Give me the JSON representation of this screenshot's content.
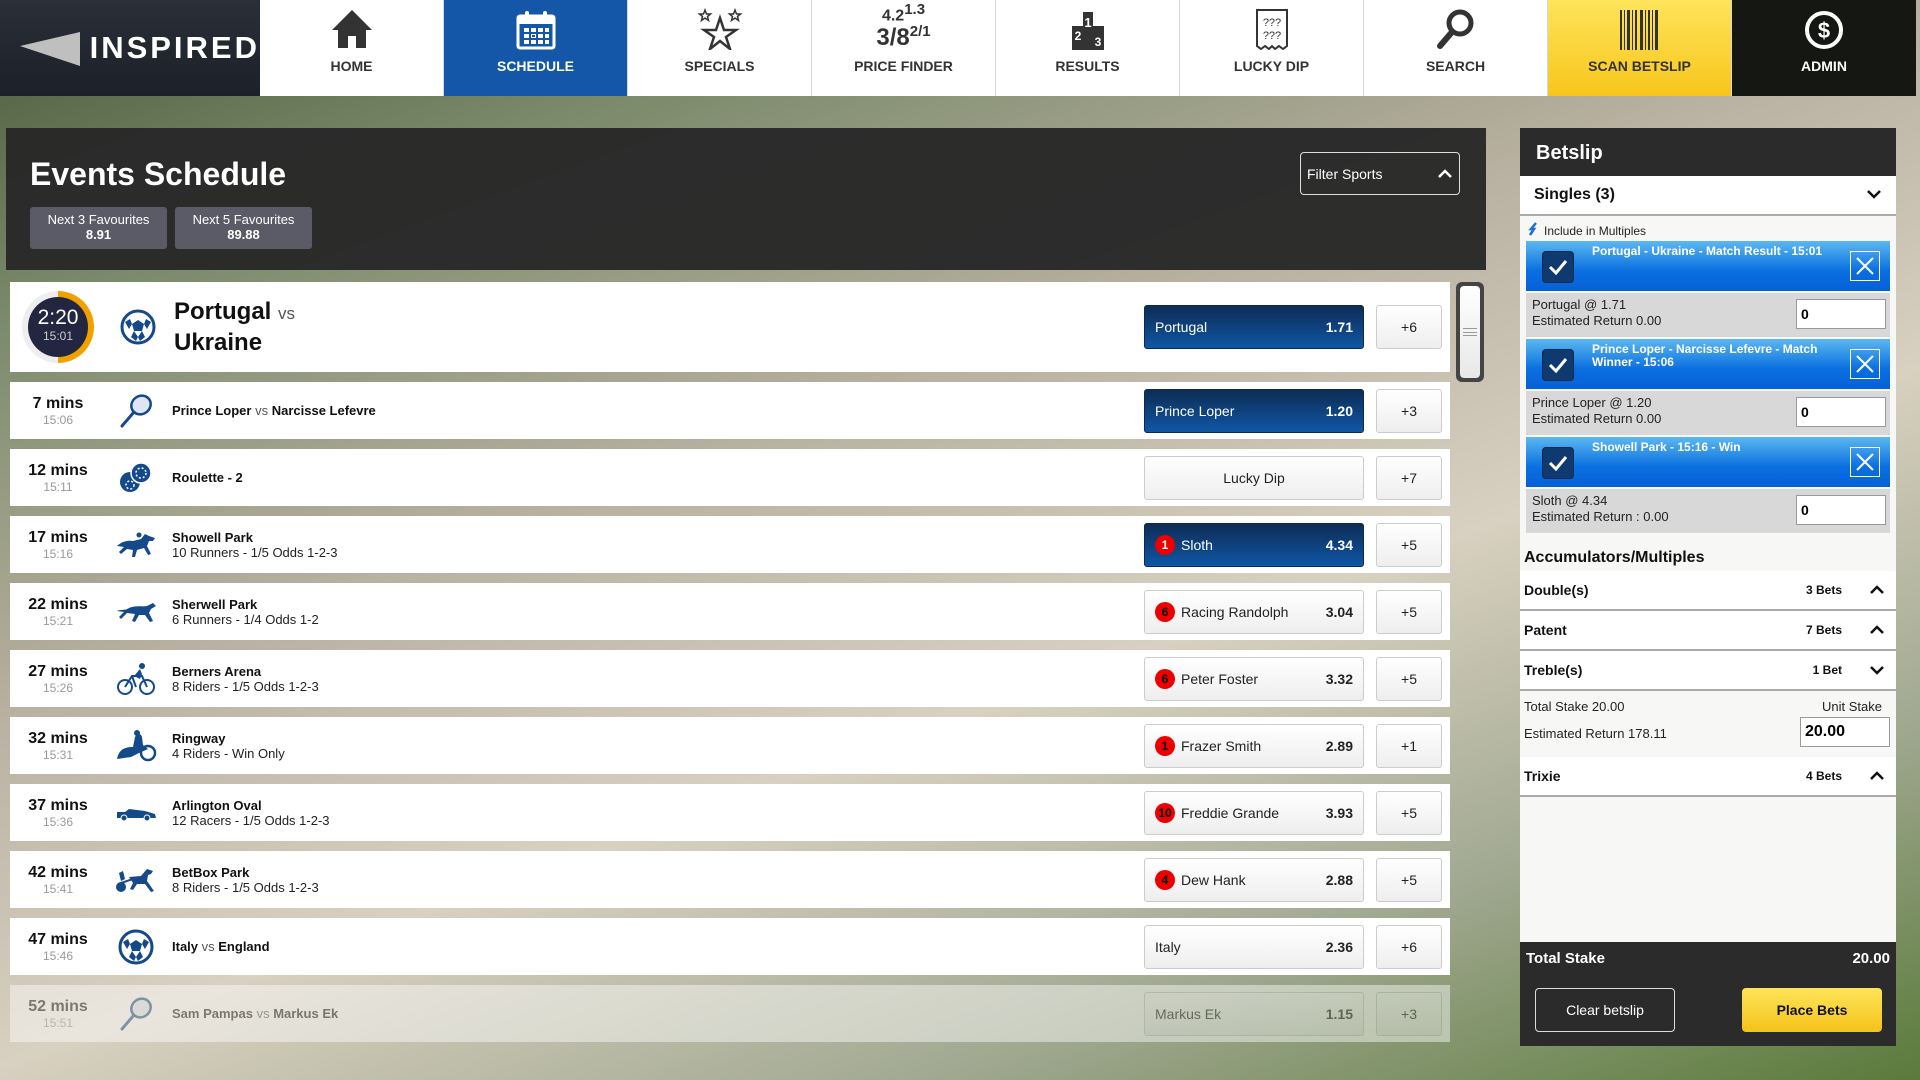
{
  "brand": {
    "name": "INSPIRED"
  },
  "nav": [
    {
      "id": "home",
      "label": "HOME",
      "icon": "home-icon"
    },
    {
      "id": "schedule",
      "label": "SCHEDULE",
      "icon": "calendar-icon",
      "active": true
    },
    {
      "id": "specials",
      "label": "SPECIALS",
      "icon": "stars-icon"
    },
    {
      "id": "price-finder",
      "label": "PRICE FINDER",
      "icon": "price-finder-icon",
      "icon_text": {
        "a": "4.2",
        "a_sup": "1.3",
        "b": "3/8",
        "b_sup": "2/1"
      }
    },
    {
      "id": "results",
      "label": "RESULTS",
      "icon": "podium-icon"
    },
    {
      "id": "lucky-dip",
      "label": "LUCKY DIP",
      "icon": "lucky-dip-icon"
    },
    {
      "id": "search",
      "label": "SEARCH",
      "icon": "search-icon"
    },
    {
      "id": "scan-betslip",
      "label": "SCAN BETSLIP",
      "icon": "barcode-icon"
    },
    {
      "id": "admin",
      "label": "ADMIN",
      "icon": "dollar-icon"
    }
  ],
  "events": {
    "title": "Events Schedule",
    "filter_label": "Filter Sports",
    "favourites": [
      {
        "label": "Next 3 Favourites",
        "value": "8.91"
      },
      {
        "label": "Next 5 Favourites",
        "value": "89.88"
      }
    ],
    "featured": {
      "countdown": "2:20",
      "time": "15:01",
      "countdown_progress": 0.5,
      "sport_icon": "football-icon",
      "home": "Portugal",
      "vs": "vs",
      "away": "Ukraine",
      "selection": "Portugal",
      "price": "1.71",
      "more": "+6",
      "selected": true
    },
    "rows": [
      {
        "mins": "7 mins",
        "time": "15:06",
        "sport_icon": "tennis-icon",
        "home": "Prince Loper",
        "vs": "vs",
        "away": "Narcisse Lefevre",
        "selection": "Prince Loper",
        "price": "1.20",
        "more": "+3",
        "selected": true
      },
      {
        "mins": "12 mins",
        "time": "15:11",
        "sport_icon": "roulette-chips-icon",
        "name": "Roulette - 2",
        "selection": "Lucky Dip",
        "more": "+7"
      },
      {
        "mins": "17 mins",
        "time": "15:16",
        "sport_icon": "horse-racing-icon",
        "name": "Showell Park",
        "sub": "10 Runners - 1/5 Odds 1-2-3",
        "badge": "1",
        "selection": "Sloth",
        "price": "4.34",
        "more": "+5",
        "selected": true
      },
      {
        "mins": "22 mins",
        "time": "15:21",
        "sport_icon": "greyhound-icon",
        "name": "Sherwell Park",
        "sub": "6 Runners - 1/4 Odds 1-2",
        "badge": "6",
        "selection": "Racing Randolph",
        "price": "3.04",
        "more": "+5"
      },
      {
        "mins": "27 mins",
        "time": "15:26",
        "sport_icon": "cycling-icon",
        "name": "Berners Arena",
        "sub": "8 Riders - 1/5 Odds 1-2-3",
        "badge": "6",
        "selection": "Peter Foster",
        "price": "3.32",
        "more": "+5"
      },
      {
        "mins": "32 mins",
        "time": "15:31",
        "sport_icon": "speedway-icon",
        "name": "Ringway",
        "sub": "4 Riders - Win Only",
        "badge": "1",
        "selection": "Frazer Smith",
        "price": "2.89",
        "more": "+1"
      },
      {
        "mins": "37 mins",
        "time": "15:36",
        "sport_icon": "motor-racing-icon",
        "name": "Arlington Oval",
        "sub": "12 Racers - 1/5 Odds 1-2-3",
        "badge": "10",
        "selection": "Freddie Grande",
        "price": "3.93",
        "more": "+5"
      },
      {
        "mins": "42 mins",
        "time": "15:41",
        "sport_icon": "harness-racing-icon",
        "name": "BetBox Park",
        "sub": "8 Riders - 1/5 Odds 1-2-3",
        "badge": "4",
        "selection": "Dew Hank",
        "price": "2.88",
        "more": "+5"
      },
      {
        "mins": "47 mins",
        "time": "15:46",
        "sport_icon": "football-icon",
        "home": "Italy",
        "vs": "vs",
        "away": "England",
        "selection": "Italy",
        "price": "2.36",
        "more": "+6"
      },
      {
        "mins": "52 mins",
        "time": "15:51",
        "sport_icon": "tennis-icon",
        "home": "Sam Pampas",
        "vs": "vs",
        "away": "Markus Ek",
        "selection": "Markus Ek",
        "price": "1.15",
        "more": "+3",
        "faded": true
      }
    ]
  },
  "betslip": {
    "title": "Betslip",
    "singles_label": "Singles (3)",
    "include_multiples": "Include in Multiples",
    "singles": [
      {
        "title": "Portugal - Ukraine - Match Result - 15:01",
        "line1": "Portugal @ 1.71",
        "line2": "Estimated Return 0.00",
        "stake": "0",
        "checked": true
      },
      {
        "title": "Prince Loper - Narcisse Lefevre - Match Winner - 15:06",
        "line1": "Prince Loper @ 1.20",
        "line2": "Estimated Return 0.00",
        "stake": "0",
        "checked": true
      },
      {
        "title": "Showell Park - 15:16 - Win",
        "line1": "Sloth @ 4.34",
        "line2": "Estimated Return : 0.00",
        "stake": "0",
        "checked": true
      }
    ],
    "acc_title": "Accumulators/Multiples",
    "multiples": [
      {
        "name": "Double(s)",
        "count": "3 Bets",
        "expanded": false
      },
      {
        "name": "Patent",
        "count": "7 Bets",
        "expanded": false
      },
      {
        "name": "Treble(s)",
        "count": "1 Bet",
        "expanded": true
      }
    ],
    "treble_detail": {
      "total_stake": "Total Stake 20.00",
      "est_return": "Estimated Return 178.11",
      "unit_stake_label": "Unit Stake",
      "unit_stake": "20.00"
    },
    "trixie": {
      "name": "Trixie",
      "count": "4 Bets",
      "expanded": false
    },
    "footer": {
      "total_label": "Total Stake",
      "total_value": "20.00",
      "clear_label": "Clear betslip",
      "place_label": "Place Bets"
    }
  }
}
